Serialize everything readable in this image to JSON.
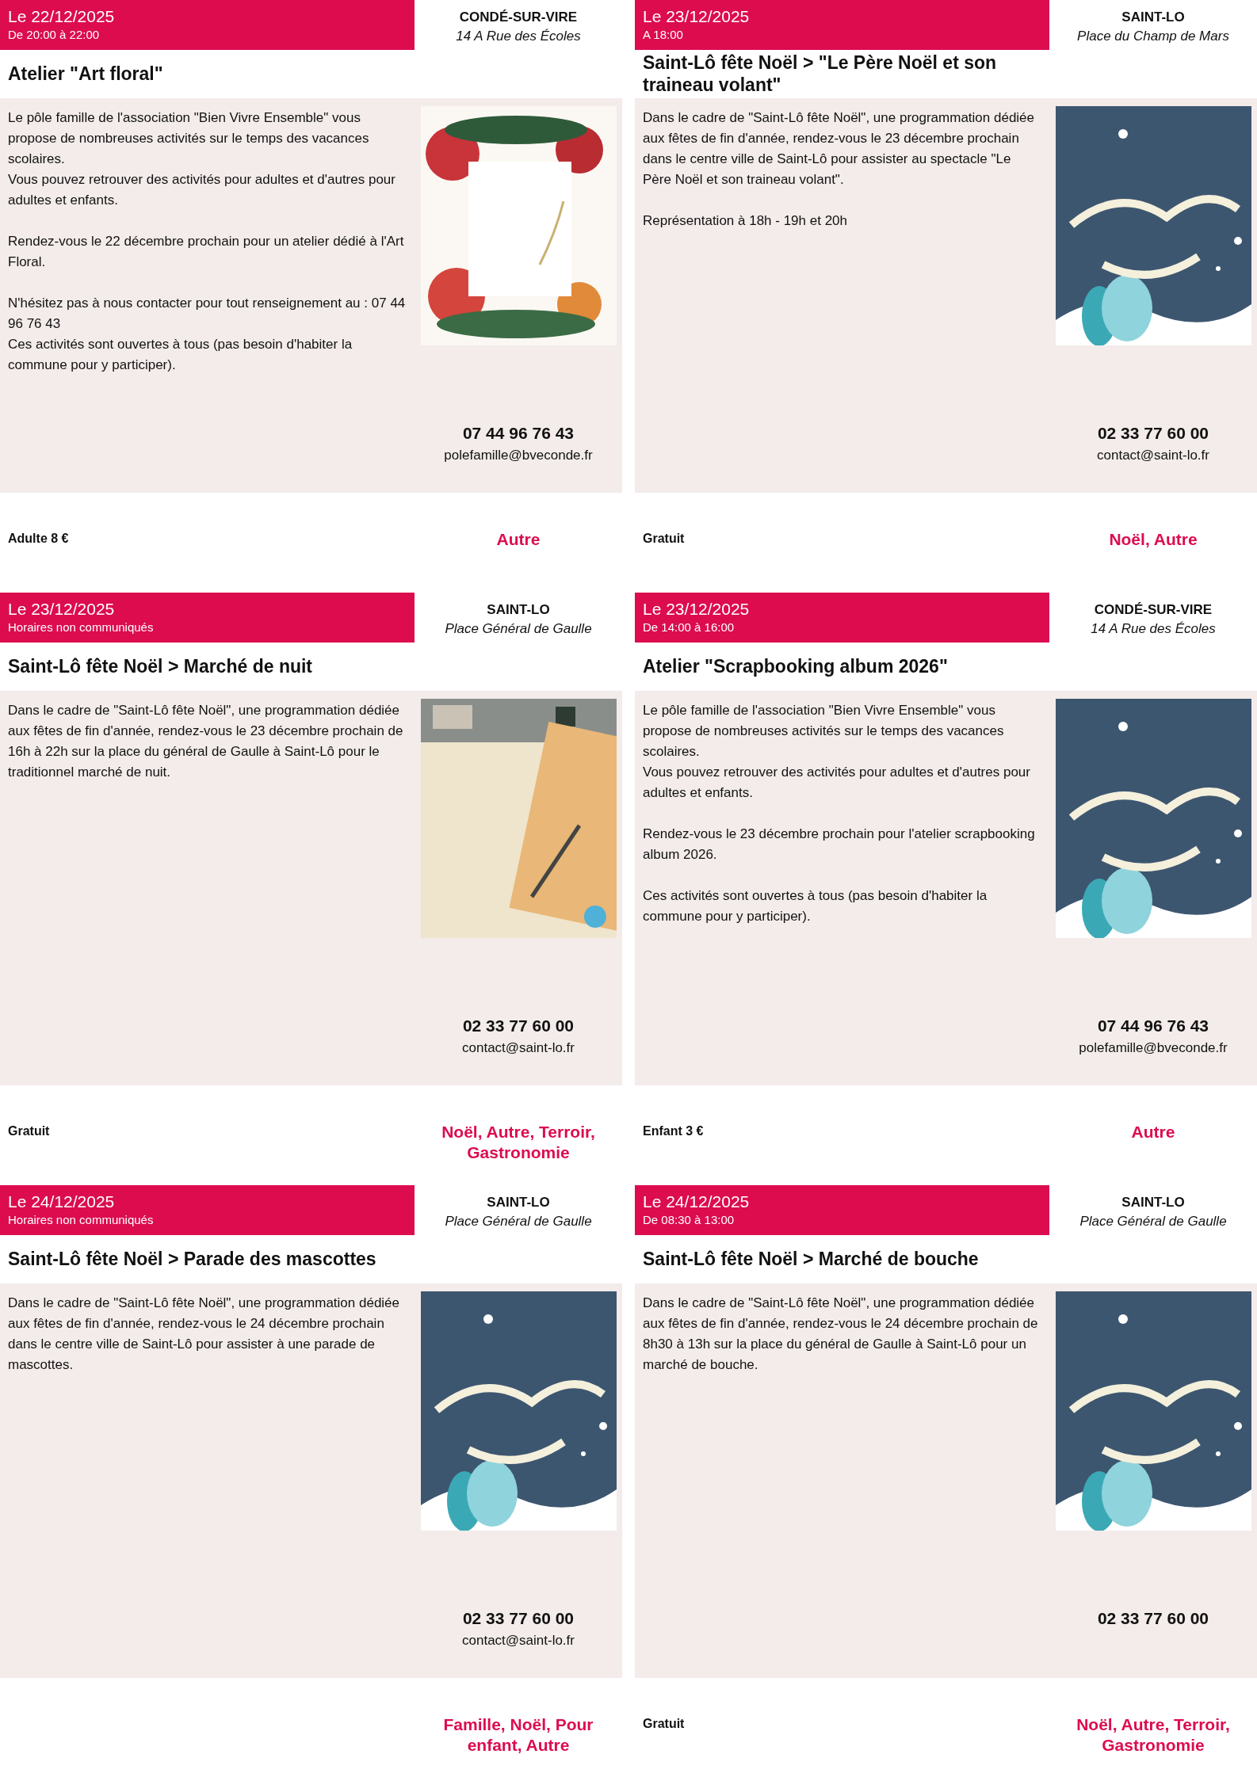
{
  "events": [
    {
      "date": "Le 22/12/2025",
      "time": "De 20:00 à 22:00",
      "title": "Atelier \"Art floral\"",
      "paragraphs": [
        "Le pôle famille de l'association \"Bien Vivre Ensemble\" vous propose de nombreuses activités sur le temps des vacances scolaires.\nVous pouvez retrouver des activités pour adultes et d'autres pour adultes et enfants.",
        "Rendez-vous le 22 décembre prochain pour un atelier dédié à l'Art Floral.",
        "N'hésitez pas à nous contacter pour tout renseignement au : 07 44 96 76 43\nCes activités sont ouvertes à tous (pas besoin d'habiter la commune pour y participer)."
      ],
      "price": "Adulte 8 €",
      "city": "CONDÉ-SUR-VIRE",
      "address": "14 A Rue des Écoles",
      "image": {
        "kind": "picture"
      },
      "phone": "07 44 96 76 43",
      "email": "polefamille@bveconde.fr",
      "categories": "Autre"
    },
    {
      "date": "Le 23/12/2025",
      "time": "A 18:00",
      "title": "Saint-Lô fête Noël > \"Le Père Noël et son traineau volant\"",
      "paragraphs": [
        "Dans le cadre de \"Saint-Lô fête Noël\", une programmation dédiée aux fêtes de fin d'année, rendez-vous le 23 décembre prochain dans le centre ville de Saint-Lô pour assister au spectacle \"Le Père Noël et son traineau volant\".",
        "Représentation à 18h - 19h et 20h"
      ],
      "price": "Gratuit",
      "city": "SAINT-LO",
      "address": "Place du Champ de Mars",
      "image": {
        "kind": "picture"
      },
      "phone": "02 33 77 60 00",
      "email": "contact@saint-lo.fr",
      "categories": "Noël, Autre"
    },
    {
      "date": "Le 23/12/2025",
      "time": "Horaires non communiqués",
      "title": "Saint-Lô fête Noël > Marché de nuit",
      "paragraphs": [
        "Dans le cadre de \"Saint-Lô fête Noël\", une programmation dédiée aux fêtes de fin d'année, rendez-vous le 23 décembre prochain de 16h à 22h sur la place du général de Gaulle à Saint-Lô pour le traditionnel marché de nuit."
      ],
      "price": "Gratuit",
      "city": "SAINT-LO",
      "address": "Place Général de Gaulle",
      "image": {
        "kind": "picture"
      },
      "phone": "02 33 77 60 00",
      "email": "contact@saint-lo.fr",
      "categories": "Noël, Autre, Terroir, Gastronomie"
    },
    {
      "date": "Le 23/12/2025",
      "time": "De 14:00 à 16:00",
      "title": "Atelier \"Scrapbooking album 2026\"",
      "paragraphs": [
        "Le pôle famille de l'association \"Bien Vivre Ensemble\" vous propose de nombreuses activités sur le temps des vacances scolaires.\nVous pouvez retrouver des activités pour adultes et d'autres pour adultes et enfants.",
        "Rendez-vous le 23 décembre prochain pour l'atelier scrapbooking album 2026.",
        "Ces activités sont ouvertes à tous (pas besoin d'habiter la commune pour y participer)."
      ],
      "price": "Enfant 3 €",
      "city": "CONDÉ-SUR-VIRE",
      "address": "14 A Rue des Écoles",
      "image": {
        "kind": "picture"
      },
      "phone": "07 44 96 76 43",
      "email": "polefamille@bveconde.fr",
      "categories": "Autre"
    },
    {
      "date": "Le 24/12/2025",
      "time": "Horaires non communiqués",
      "title": "Saint-Lô fête Noël > Parade des mascottes",
      "paragraphs": [
        "Dans le cadre de \"Saint-Lô fête Noël\", une programmation dédiée aux fêtes de fin d'année, rendez-vous le 24 décembre prochain dans le centre ville de Saint-Lô pour assister à une parade de mascottes."
      ],
      "city": "SAINT-LO",
      "address": "Place Général de Gaulle",
      "image": {
        "kind": "picture"
      },
      "phone": "02 33 77 60 00",
      "email": "contact@saint-lo.fr",
      "categories": "Famille, Noël, Pour enfant, Autre"
    },
    {
      "date": "Le 24/12/2025",
      "time": "De 08:30 à 13:00",
      "title": "Saint-Lô fête Noël > Marché de bouche",
      "paragraphs": [
        "Dans le cadre de \"Saint-Lô fête Noël\", une programmation dédiée aux fêtes de fin d'année, rendez-vous le 24 décembre prochain de 8h30 à 13h sur la place du général de Gaulle à Saint-Lô pour un marché de bouche."
      ],
      "price": "Gratuit",
      "city": "SAINT-LO",
      "address": "Place Général de Gaulle",
      "image": {
        "kind": "picture"
      },
      "phone": "02 33 77 60 00",
      "categories": "Noël, Autre, Terroir, Gastronomie"
    }
  ]
}
